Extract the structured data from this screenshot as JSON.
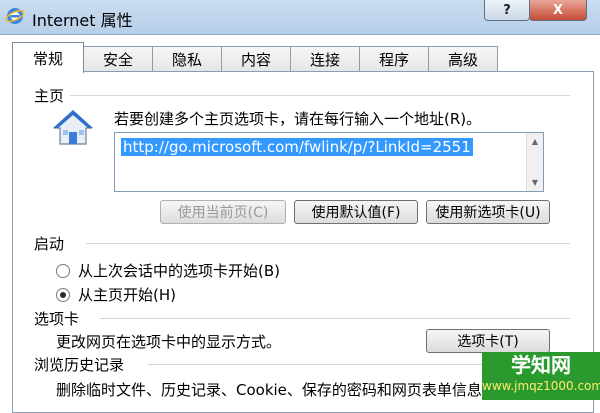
{
  "window": {
    "title": "Internet 属性",
    "help_label": "?",
    "close_label": "X"
  },
  "tabs": [
    {
      "label": "常规"
    },
    {
      "label": "安全"
    },
    {
      "label": "隐私"
    },
    {
      "label": "内容"
    },
    {
      "label": "连接"
    },
    {
      "label": "程序"
    },
    {
      "label": "高级"
    }
  ],
  "homepage": {
    "group_label": "主页",
    "instructions": "若要创建多个主页选项卡，请在每行输入一个地址(R)。",
    "url": "http://go.microsoft.com/fwlink/p/?LinkId=2551",
    "btn_use_current": "使用当前页(C)",
    "btn_use_default": "使用默认值(F)",
    "btn_use_new_tab": "使用新选项卡(U)"
  },
  "startup": {
    "group_label": "启动",
    "option_last_session": "从上次会话中的选项卡开始(B)",
    "option_homepage": "从主页开始(H)"
  },
  "tabs_section": {
    "group_label": "选项卡",
    "description": "更改网页在选项卡中的显示方式。",
    "btn_tabs": "选项卡(T)"
  },
  "history": {
    "group_label": "浏览历史记录",
    "description": "删除临时文件、历史记录、Cookie、保存的密码和网页表单信息"
  },
  "watermark": {
    "main": "学知网",
    "sub": "www.jmqz1000.com"
  },
  "colors": {
    "selection": "#3399ff",
    "watermark_bg": "#2a9a2f"
  },
  "icons": [
    "ie-icon",
    "home-icon",
    "radio-icon"
  ]
}
